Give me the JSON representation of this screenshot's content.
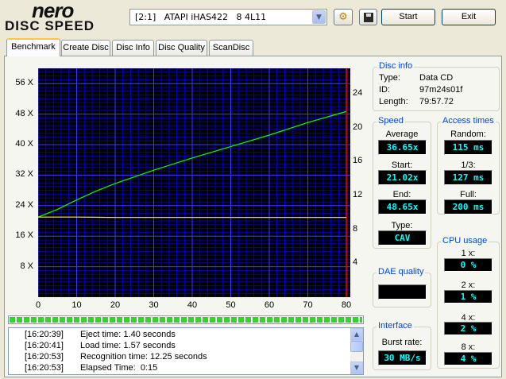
{
  "app": {
    "logo_top": "nero",
    "logo_bottom": "DISC SPEED"
  },
  "toolbar": {
    "drive_selected": "[2:1]   ATAPI iHAS422   8 4L11",
    "start_label": "Start",
    "exit_label": "Exit"
  },
  "tabs": [
    "Benchmark",
    "Create Disc",
    "Disc Info",
    "Disc Quality",
    "ScanDisc"
  ],
  "chart_data": {
    "type": "line",
    "x_axis": {
      "ticks": [
        0,
        10,
        20,
        30,
        40,
        50,
        60,
        70,
        80
      ],
      "range": [
        0,
        80
      ]
    },
    "y_left": {
      "tick_labels": [
        "8 X",
        "16 X",
        "24 X",
        "32 X",
        "40 X",
        "48 X",
        "56 X"
      ],
      "ticks": [
        8,
        16,
        24,
        32,
        40,
        48,
        56
      ],
      "range": [
        0,
        60
      ]
    },
    "y_right": {
      "ticks": [
        4,
        8,
        12,
        16,
        20,
        24
      ],
      "range": [
        0,
        27
      ]
    },
    "series": [
      {
        "color": "#00ff00",
        "x": [
          0,
          5,
          10,
          15,
          20,
          30,
          40,
          50,
          60,
          70,
          80
        ],
        "values": [
          21.0,
          23.0,
          25.5,
          27.8,
          29.8,
          33.3,
          36.5,
          39.5,
          42.5,
          45.8,
          48.7
        ]
      },
      {
        "color": "#ffff00",
        "x": [
          0,
          10,
          20,
          40,
          60,
          80
        ],
        "values": [
          21.0,
          21.0,
          20.9,
          20.9,
          20.9,
          20.9
        ]
      }
    ],
    "grid": true,
    "background": "#000000",
    "grid_color": "#0000c8",
    "end_marker_color": "#ff0000"
  },
  "progress": {
    "percent": 100,
    "color": "#2fd62f"
  },
  "log": [
    {
      "time": "[16:20:39]",
      "text": "Eject time: 1.40 seconds"
    },
    {
      "time": "[16:20:41]",
      "text": "Load time: 1.57 seconds"
    },
    {
      "time": "[16:20:53]",
      "text": "Recognition time: 12.25 seconds"
    },
    {
      "time": "[16:20:53]",
      "text": "Elapsed Time:  0:15"
    }
  ],
  "disc_info": {
    "title": "Disc info",
    "type_label": "Type:",
    "type_value": "Data CD",
    "id_label": "ID:",
    "id_value": "97m24s01f",
    "length_label": "Length:",
    "length_value": "79:57.72"
  },
  "speed": {
    "title": "Speed",
    "average_label": "Average",
    "average_value": "36.65x",
    "start_label": "Start:",
    "start_value": "21.02x",
    "end_label": "End:",
    "end_value": "48.65x",
    "type_label": "Type:",
    "type_value": "CAV"
  },
  "access_times": {
    "title": "Access times",
    "random_label": "Random:",
    "random_value": "115 ms",
    "third_label": "1/3:",
    "third_value": "127 ms",
    "full_label": "Full:",
    "full_value": "200 ms"
  },
  "cpu_usage": {
    "title": "CPU usage",
    "x1_label": "1 x:",
    "x1_value": "0 %",
    "x2_label": "2 x:",
    "x2_value": "1 %",
    "x4_label": "4 x:",
    "x4_value": "2 %",
    "x8_label": "8 x:",
    "x8_value": "4 %"
  },
  "dae_quality": {
    "title": "DAE quality",
    "value": ""
  },
  "interface": {
    "title": "Interface",
    "burst_label": "Burst rate:",
    "burst_value": "30 MB/s"
  }
}
